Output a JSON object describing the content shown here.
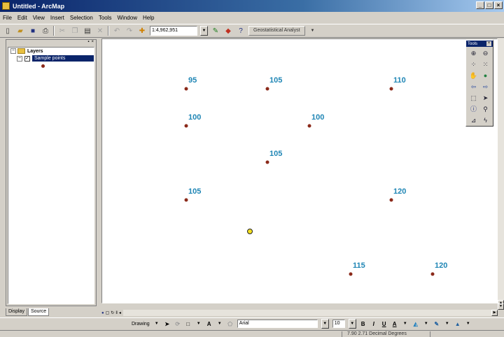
{
  "window": {
    "title": "Untitled - ArcMap",
    "buttons": [
      "_",
      "□",
      "×"
    ]
  },
  "menu": [
    "File",
    "Edit",
    "View",
    "Insert",
    "Selection",
    "Tools",
    "Window",
    "Help"
  ],
  "toolbar": {
    "scale": "1:4,962,951",
    "geostat_label": "Geostatistical Analyst"
  },
  "toc": {
    "layers_label": "Layers",
    "layer_name": "Sample points",
    "tabs": {
      "display": "Display",
      "source": "Source"
    }
  },
  "map": {
    "point_color": "#8b2a1a",
    "label_color": "#1f86b5",
    "points": [
      {
        "label": "95"
      },
      {
        "label": "105"
      },
      {
        "label": "110"
      },
      {
        "label": "100"
      },
      {
        "label": "100"
      },
      {
        "label": "105"
      },
      {
        "label": "105"
      },
      {
        "label": "120"
      },
      {
        "label": "115"
      },
      {
        "label": "120"
      }
    ]
  },
  "tools_panel": {
    "title": "Tools"
  },
  "drawing": {
    "label": "Drawing",
    "font": "Arial",
    "size": "10"
  },
  "status": {
    "coords": "7.90  2.71 Decimal Degrees"
  }
}
